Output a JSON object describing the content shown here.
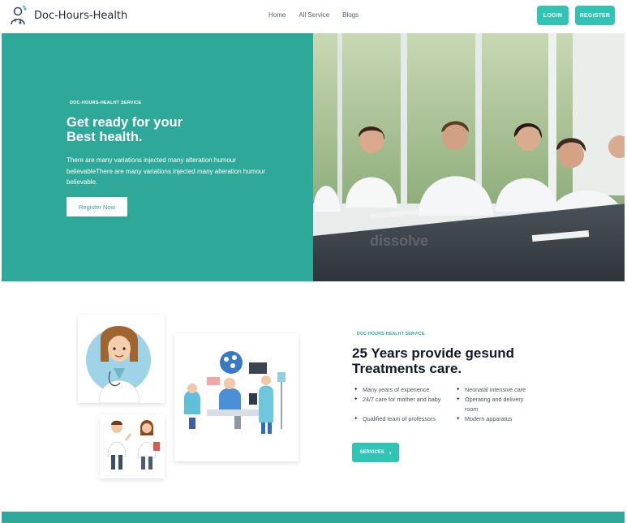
{
  "header": {
    "brand": "Doc-Hours-Health",
    "nav": [
      "Home",
      "All Service",
      "Blogs"
    ],
    "login_label": "LOGIN",
    "register_label": "REGISTER"
  },
  "hero": {
    "eyebrow": "DOC-HOURS-HEALHT SERVICE",
    "title_line1": "Get ready for your",
    "title_line2": "Best health.",
    "text": "There are many variations injected many alteration humour believableThere are many variations injected many alteration humour believable.",
    "button_label": "Register Now",
    "image_caption": "dissolve"
  },
  "about": {
    "eyebrow": "DOC-HOURS-HEALHT SERVICE",
    "title_line1": "25 Years provide gesund",
    "title_line2": "Treatments care.",
    "features_left": [
      "Many years of experience",
      "24/7 care for mother and baby",
      "Qualified team of professors"
    ],
    "features_right": [
      "Neonatal intensive care",
      "Operating and delivery room",
      "Modern apparatus"
    ],
    "button_label": "SERVICES",
    "button_icon": "chevron-right-icon"
  },
  "colors": {
    "primary": "#2ea899",
    "button": "#31c3b4"
  }
}
